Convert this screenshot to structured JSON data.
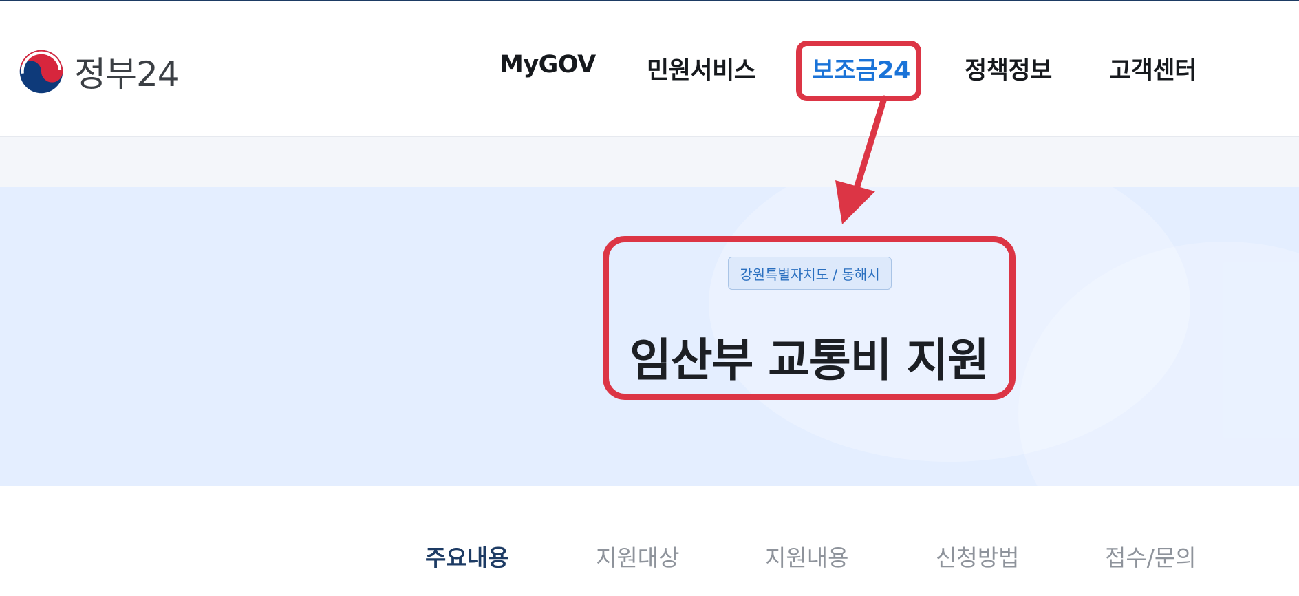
{
  "header": {
    "logo_text": "정부24",
    "nav": [
      {
        "label": "MyGOV"
      },
      {
        "label": "민원서비스"
      },
      {
        "label": "보조금24",
        "active": true
      },
      {
        "label": "정책정보"
      },
      {
        "label": "고객센터"
      }
    ]
  },
  "hero": {
    "region_tag": "강원특별자치도 / 동해시",
    "title": "임산부 교통비 지원"
  },
  "tabs": [
    {
      "label": "주요내용",
      "active": true
    },
    {
      "label": "지원대상"
    },
    {
      "label": "지원내용"
    },
    {
      "label": "신청방법"
    },
    {
      "label": "접수/문의"
    }
  ],
  "colors": {
    "accent": "#1a73d8",
    "annotation": "#dc3545",
    "navy": "#1d3b64",
    "hero_bg": "#e4eeff"
  }
}
